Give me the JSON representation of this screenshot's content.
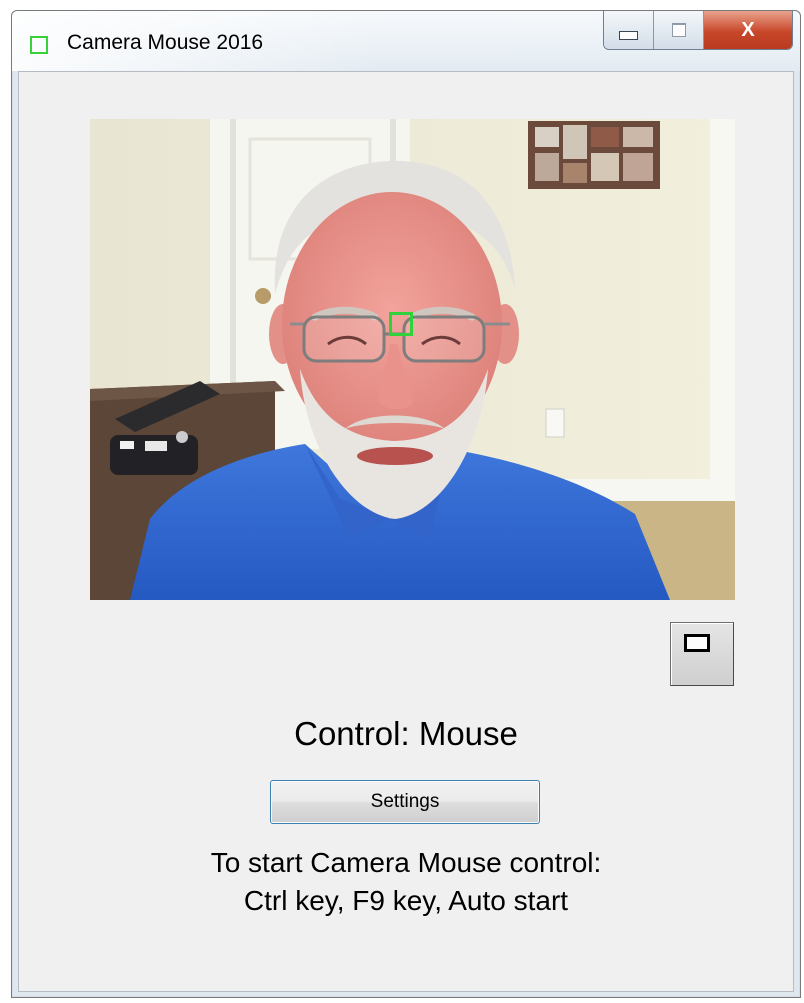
{
  "window": {
    "title": "Camera Mouse 2016",
    "app_icon": "green-square-icon",
    "accent_color": "#39d13a",
    "buttons": [
      {
        "name": "minimize",
        "icon": "minimize-icon"
      },
      {
        "name": "maximize",
        "icon": "maximize-icon"
      },
      {
        "name": "close",
        "icon": "close-icon",
        "glyph": "X",
        "color": "#c8472a"
      }
    ]
  },
  "video": {
    "tracking_icon": "tracking-square-icon",
    "tracking_color": "#2fd23a"
  },
  "tracking_button": {
    "icon": "square-outline-icon"
  },
  "control": {
    "text": "Control: Mouse"
  },
  "settings_button": {
    "label": "Settings",
    "border_color": "#3c7fb1"
  },
  "instructions": {
    "line1": "To start Camera Mouse control:",
    "line2": "Ctrl key, F9 key, Auto start"
  }
}
